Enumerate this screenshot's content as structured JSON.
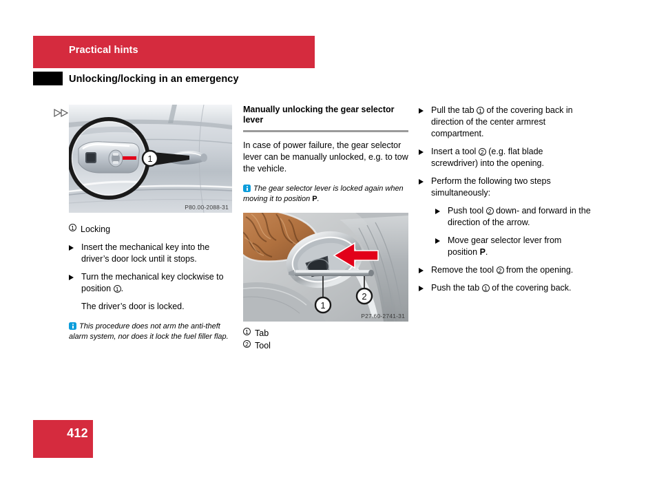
{
  "header": {
    "chapter_title": "Practical hints",
    "section_title": "Unlocking/locking in an emergency",
    "chapter_bar_color": "#d52b3e",
    "section_tab_color": "#000000"
  },
  "footer": {
    "page_number": "412",
    "block_color": "#d52b3e"
  },
  "turn_marker": "continuation-arrows",
  "left_column": {
    "figure": {
      "caption": "P80.00-2088-31",
      "callout_1": "1",
      "alt": "Car driver door handle with magnified inset showing mechanical key lock cylinder"
    },
    "legend": [
      {
        "num": "1",
        "label": "Locking"
      }
    ],
    "steps": [
      {
        "text_before": "Insert the mechanical key into the driver’s door lock until it stops."
      },
      {
        "text_before": "Turn the mechanical key clockwise to position ",
        "num": "1",
        "text_after": "."
      }
    ],
    "result_text": "The driver’s door is locked.",
    "note": "This procedure does not arm the anti-theft alarm system, nor does it lock the fuel filler flap."
  },
  "middle_column": {
    "heading": "Manually unlocking the gear selector lever",
    "paragraph": "In case of power failure, the gear selector lever can be manually unlocked, e.g. to tow the vehicle.",
    "note_before": "The gear selector lever is locked again when moving it to position ",
    "note_bold": "P",
    "note_after": ".",
    "figure": {
      "caption": "P27.60-2741-31",
      "callout_1": "1",
      "callout_2": "2",
      "alt": "Center console gear selector opening with covering tab and flat blade tool, red arrow indicating push direction"
    },
    "legend": [
      {
        "num": "1",
        "label": "Tab"
      },
      {
        "num": "2",
        "label": "Tool"
      }
    ]
  },
  "right_column": {
    "steps": [
      {
        "level": "top",
        "segments": [
          {
            "type": "text",
            "value": "Pull the tab "
          },
          {
            "type": "num",
            "value": "1"
          },
          {
            "type": "text",
            "value": " of the covering back in direction of the center armrest compartment."
          }
        ]
      },
      {
        "level": "top",
        "segments": [
          {
            "type": "text",
            "value": "Insert a tool "
          },
          {
            "type": "num",
            "value": "2"
          },
          {
            "type": "text",
            "value": " (e.g. flat blade screwdriver) into the opening."
          }
        ]
      },
      {
        "level": "top",
        "segments": [
          {
            "type": "text",
            "value": "Perform the following two steps simultaneously:"
          }
        ]
      },
      {
        "level": "sub",
        "segments": [
          {
            "type": "text",
            "value": "Push tool "
          },
          {
            "type": "num",
            "value": "2"
          },
          {
            "type": "text",
            "value": " down- and forward in the direction of the arrow."
          }
        ]
      },
      {
        "level": "sub",
        "segments": [
          {
            "type": "text",
            "value": "Move gear selector lever from position "
          },
          {
            "type": "bold",
            "value": "P"
          },
          {
            "type": "text",
            "value": "."
          }
        ]
      },
      {
        "level": "top",
        "segments": [
          {
            "type": "text",
            "value": "Remove the tool "
          },
          {
            "type": "num",
            "value": "2"
          },
          {
            "type": "text",
            "value": " from the opening."
          }
        ]
      },
      {
        "level": "top",
        "segments": [
          {
            "type": "text",
            "value": "Push the tab "
          },
          {
            "type": "num",
            "value": "1"
          },
          {
            "type": "text",
            "value": " of the covering back."
          }
        ]
      }
    ]
  }
}
